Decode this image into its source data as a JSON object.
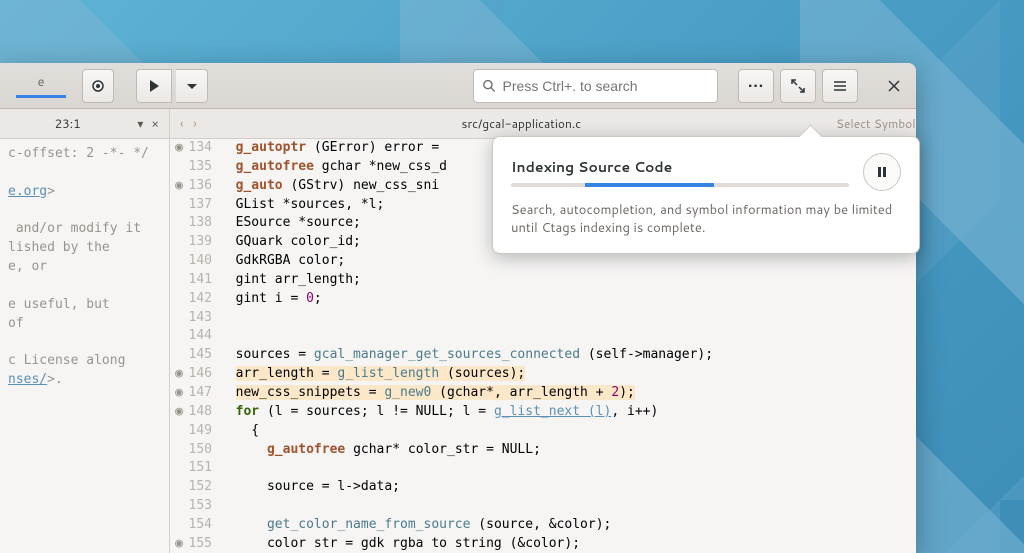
{
  "header": {
    "title": "e",
    "search_placeholder": "Press Ctrl+. to search"
  },
  "subheader": {
    "left_pos": "23:1",
    "file_path": "src/gcal-application.c",
    "right_info": "Select Symbol"
  },
  "sidebar": {
    "lines": [
      "c-offset: 2 -*- */",
      "",
      "e.org>",
      "",
      " and/or modify it",
      "lished by the",
      "e, or",
      "",
      "e useful, but",
      "of",
      "",
      "c License along",
      "nses/>."
    ]
  },
  "code": [
    {
      "n": 134,
      "mark": "◉",
      "html": "<span class='fn'>g_autoptr</span> (GError) error ="
    },
    {
      "n": 135,
      "mark": "",
      "html": "<span class='fn'>g_autofree</span> gchar *new_css_d"
    },
    {
      "n": 136,
      "mark": "◉",
      "html": "<span class='fn'>g_auto</span> (GStrv) new_css_sni"
    },
    {
      "n": 137,
      "mark": "",
      "html": "GList *sources, *l;"
    },
    {
      "n": 138,
      "mark": "",
      "html": "ESource *source;"
    },
    {
      "n": 139,
      "mark": "",
      "html": "GQuark color_id;"
    },
    {
      "n": 140,
      "mark": "",
      "html": "GdkRGBA color;"
    },
    {
      "n": 141,
      "mark": "",
      "html": "gint arr_length;"
    },
    {
      "n": 142,
      "mark": "",
      "html": "gint i = <span class='num'>0</span>;"
    },
    {
      "n": 143,
      "mark": "",
      "html": ""
    },
    {
      "n": 144,
      "mark": "",
      "html": ""
    },
    {
      "n": 145,
      "mark": "",
      "html": "sources = <span class='id'>gcal_manager_get_sources_connected</span> (self-&gt;manager);"
    },
    {
      "n": 146,
      "mark": "◉",
      "html": "<span class='mod'>arr_length = <span class='id'>g_list_length</span> (sources);</span>"
    },
    {
      "n": 147,
      "mark": "◉",
      "html": "<span class='mod'>new_css_snippets = <span class='id'>g_new0</span> (gchar*, arr_length + <span class='num'>2</span>);</span>"
    },
    {
      "n": 148,
      "mark": "◉",
      "html": "<span class='kw'>for</span> (l = sources; l != NULL; l = <span class='call'>g_list_next (l)</span>, i++)"
    },
    {
      "n": 149,
      "mark": "",
      "html": "  {"
    },
    {
      "n": 150,
      "mark": "",
      "html": "    <span class='fn'>g_autofree</span> gchar* color_str = NULL;"
    },
    {
      "n": 151,
      "mark": "",
      "html": ""
    },
    {
      "n": 152,
      "mark": "",
      "html": "    source = l-&gt;data;"
    },
    {
      "n": 153,
      "mark": "",
      "html": ""
    },
    {
      "n": 154,
      "mark": "",
      "html": "    <span class='id'>get_color_name_from_source</span> (source, &amp;color);"
    },
    {
      "n": 155,
      "mark": "◉",
      "html": "    color str = gdk rgba to string (&amp;color);"
    }
  ],
  "popover": {
    "title": "Indexing Source Code",
    "message": "Search, autocompletion, and symbol information may be limited until Ctags indexing is complete."
  }
}
